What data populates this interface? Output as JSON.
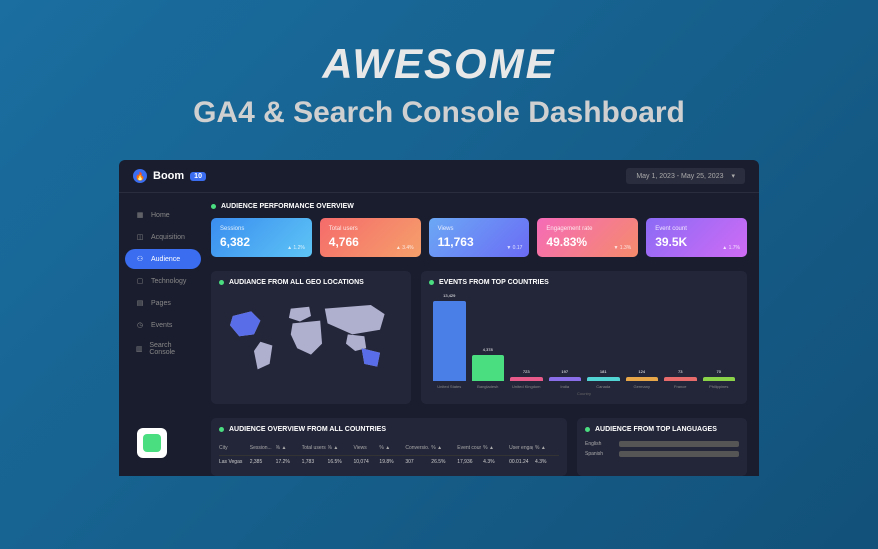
{
  "hero": {
    "title": "AWESOME",
    "subtitle": "GA4 & Search Console Dashboard"
  },
  "brand": {
    "name": "Boom",
    "badge": "10"
  },
  "date_range": "May 1, 2023 - May 25, 2023",
  "sidebar": {
    "items": [
      {
        "label": "Home"
      },
      {
        "label": "Acquisition"
      },
      {
        "label": "Audience"
      },
      {
        "label": "Technology"
      },
      {
        "label": "Pages"
      },
      {
        "label": "Events"
      },
      {
        "label": "Search Console"
      }
    ]
  },
  "overview": {
    "title": "AUDIENCE PERFORMANCE OVERVIEW",
    "cards": [
      {
        "label": "Sessions",
        "value": "6,382",
        "delta": "▲ 1.2%",
        "gradient": "linear-gradient(135deg,#3a8df0,#5ec5f5)"
      },
      {
        "label": "Total users",
        "value": "4,766",
        "delta": "▲ 3.4%",
        "gradient": "linear-gradient(135deg,#f56b6b,#f5a06b)"
      },
      {
        "label": "Views",
        "value": "11,763",
        "delta": "▼ 0.17",
        "gradient": "linear-gradient(135deg,#6ba8f5,#6b6bf5)"
      },
      {
        "label": "Engagement rate",
        "value": "49.83%",
        "delta": "▼ 1.3%",
        "gradient": "linear-gradient(135deg,#f56bb8,#f58b6b)"
      },
      {
        "label": "Event count",
        "value": "39.5K",
        "delta": "▲ 1.7%",
        "gradient": "linear-gradient(135deg,#8b6bf5,#d06bf5)"
      }
    ]
  },
  "geo": {
    "title": "AUDIANCE FROM ALL GEO LOCATIONS"
  },
  "chart_data": {
    "type": "bar",
    "title": "EVENTS FROM TOP COUNTRIES",
    "xlabel": "Country",
    "categories": [
      "United States",
      "Bangladesh",
      "United Kingdom",
      "India",
      "Canada",
      "Germany",
      "France",
      "Philippines"
    ],
    "values": [
      13429,
      4378,
      723,
      197,
      181,
      124,
      73,
      70
    ],
    "colors": [
      "#4a7fe8",
      "#4ade80",
      "#e85a8a",
      "#8a6de8",
      "#52d4d4",
      "#e8a84a",
      "#e86b6b",
      "#8bd44a"
    ]
  },
  "table": {
    "title": "AUDIENCE OVERVIEW FROM ALL COUNTRIES",
    "columns": [
      "City",
      "Session...",
      "% ▲",
      "Total users",
      "% ▲",
      "Views",
      "% ▲",
      "Conversio...",
      "% ▲",
      "Event count",
      "% ▲",
      "User engage...",
      "% ▲"
    ],
    "rows": [
      [
        "Las Vegas",
        "2,385",
        "17.2%",
        "1,783",
        "16.5%",
        "10,074",
        "19.8%",
        "307",
        "26.5%",
        "17,936",
        "4.3%",
        "00.01.24",
        "4.3%"
      ]
    ]
  },
  "lang": {
    "title": "AUDIENCE FROM TOP LANGUAGES",
    "items": [
      {
        "name": "English",
        "width": "90%"
      },
      {
        "name": "Spanish",
        "width": "15%"
      }
    ]
  }
}
